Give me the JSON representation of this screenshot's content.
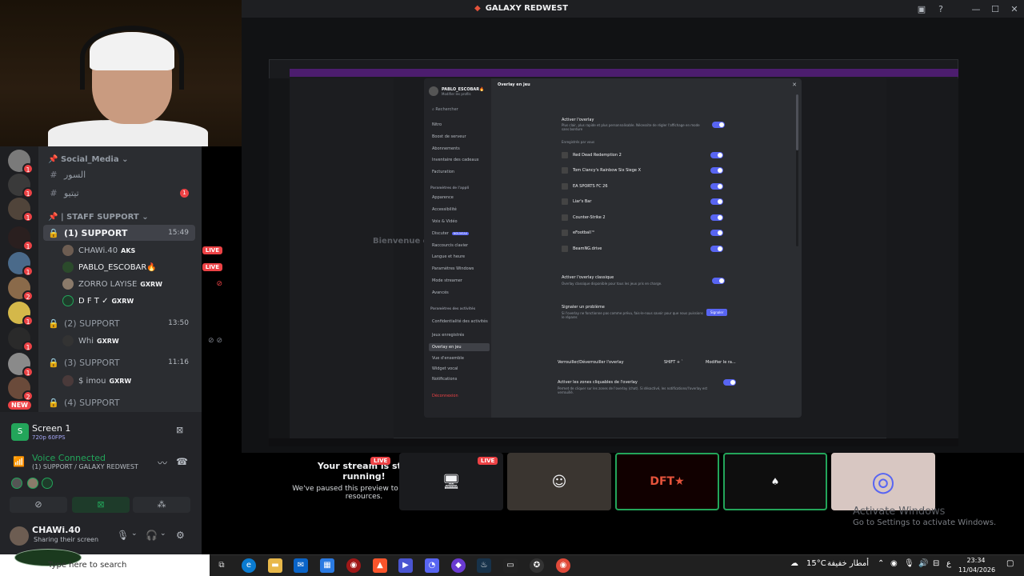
{
  "window": {
    "title": "GALAXY REDWEST"
  },
  "servers": {
    "new_label": "NEW",
    "badges": [
      "1",
      "1",
      "1",
      "1",
      "1",
      "1",
      "2",
      "1",
      "1",
      "1",
      "1",
      "2"
    ]
  },
  "channels": {
    "cat_social": "Social_Media",
    "ch_sour": "السور",
    "ch_tiktok": "تيتيو",
    "ch_tiktok_unread": "1",
    "cat_staff": "| STAFF SUPPORT",
    "support1": {
      "label": "(1) SUPPORT",
      "time": "15:49"
    },
    "voice_users": [
      {
        "name": "CHAWi.40",
        "tag": "AKS",
        "live": "LIVE"
      },
      {
        "name": "PABLO_ESCOBAR🔥",
        "live": "LIVE"
      },
      {
        "name": "ZORRO LAYISE",
        "tag": "GXRW"
      },
      {
        "name": "D F T ✓",
        "tag": "GXRW"
      }
    ],
    "support2": {
      "label": "(2) SUPPORT",
      "time": "13:50"
    },
    "support2_user": {
      "name": "Whi",
      "tag": "GXRW"
    },
    "support3": {
      "label": "(3) SUPPORT",
      "time": "11:16"
    },
    "support3_user": {
      "name": "$ imou",
      "tag": "GXRW"
    },
    "support4": {
      "label": "(4) SUPPORT"
    }
  },
  "screen": {
    "title": "Screen 1",
    "sub": "720p 60FPS"
  },
  "voice": {
    "title": "Voice Connected",
    "sub": "(1) SUPPORT / GALAXY REDWEST"
  },
  "user": {
    "name": "CHAWi.40",
    "status": "Sharing their screen"
  },
  "stream": {
    "paused_title": "Your stream is still running!",
    "paused_sub": "We've paused this preview to save your resources.",
    "live": "LIVE",
    "activate_title": "Activate Windows",
    "activate_sub": "Go to Settings to activate Windows."
  },
  "modal": {
    "username": "PABLO_ESCOBAR🔥",
    "user_status": "Modifier les profils",
    "title": "Overlay en jeu",
    "search": "Rechercher",
    "items_top": [
      "Nitro",
      "Boost de serveur",
      "Abonnements",
      "Inventaire des cadeaux",
      "Facturation"
    ],
    "sec_app": "Paramètres de l'appli",
    "items_app": [
      "Apparence",
      "Accessibilité",
      "Voix & Vidéo",
      "Discuter",
      "Raccourcis clavier",
      "Langue et heure",
      "Paramètres Windows",
      "Mode streamer",
      "Avancés"
    ],
    "new_badge": "NOUVEAU",
    "sec_activity": "Paramètres des activités",
    "items_activity": [
      "Confidentialité des activités",
      "Jeux enregistrés",
      "Overlay en jeu",
      "Vue d'ensemble",
      "Widget vocal",
      "Notifications"
    ],
    "item_logout": "Déconnexion",
    "enable_overlay": "Activer l'overlay",
    "enable_overlay_desc": "Plus clair, plus rapide et plus personnalisable. Nécessite de régler l'affichage en mode sans bordure",
    "registered": "Enregistrés par vous",
    "games": [
      "Red Dead Redemption 2",
      "Tom Clancy's Rainbow Six Siege X",
      "EA SPORTS FC 26",
      "Liar's Bar",
      "Counter-Strike 2",
      "eFootball™",
      "BeamNG.drive"
    ],
    "classic_title": "Activer l'overlay classique",
    "classic_desc": "Overlay classique disponible pour tous les jeux pris en charge.",
    "report_title": "Signaler un problème",
    "report_desc": "Si l'overlay ne fonctionne pas comme prévu, fais-le-nous savoir pour que nous puissions le réparer.",
    "report_btn": "Signaler",
    "lock_title": "Verrouiller/Déverrouiller l'overlay",
    "lock_key": "SHIFT + `",
    "lock_edit": "Modifier le ra...",
    "click_title": "Activer les zones cliquables de l'overlay",
    "click_desc": "Permet de cliquer sur les zones de l'overlay (chat). Si désactivé, les notifications/l'overlay est verrouillé."
  },
  "inner": {
    "banner": "GALAXY REDWEST",
    "welcome": "Bienvenue da"
  },
  "taskbar": {
    "search": "Type here to search",
    "weather": "15°C",
    "weather_text": "أمطار خفيفة",
    "lang": "ع",
    "time": "23:34",
    "date": "11/04/2026"
  }
}
